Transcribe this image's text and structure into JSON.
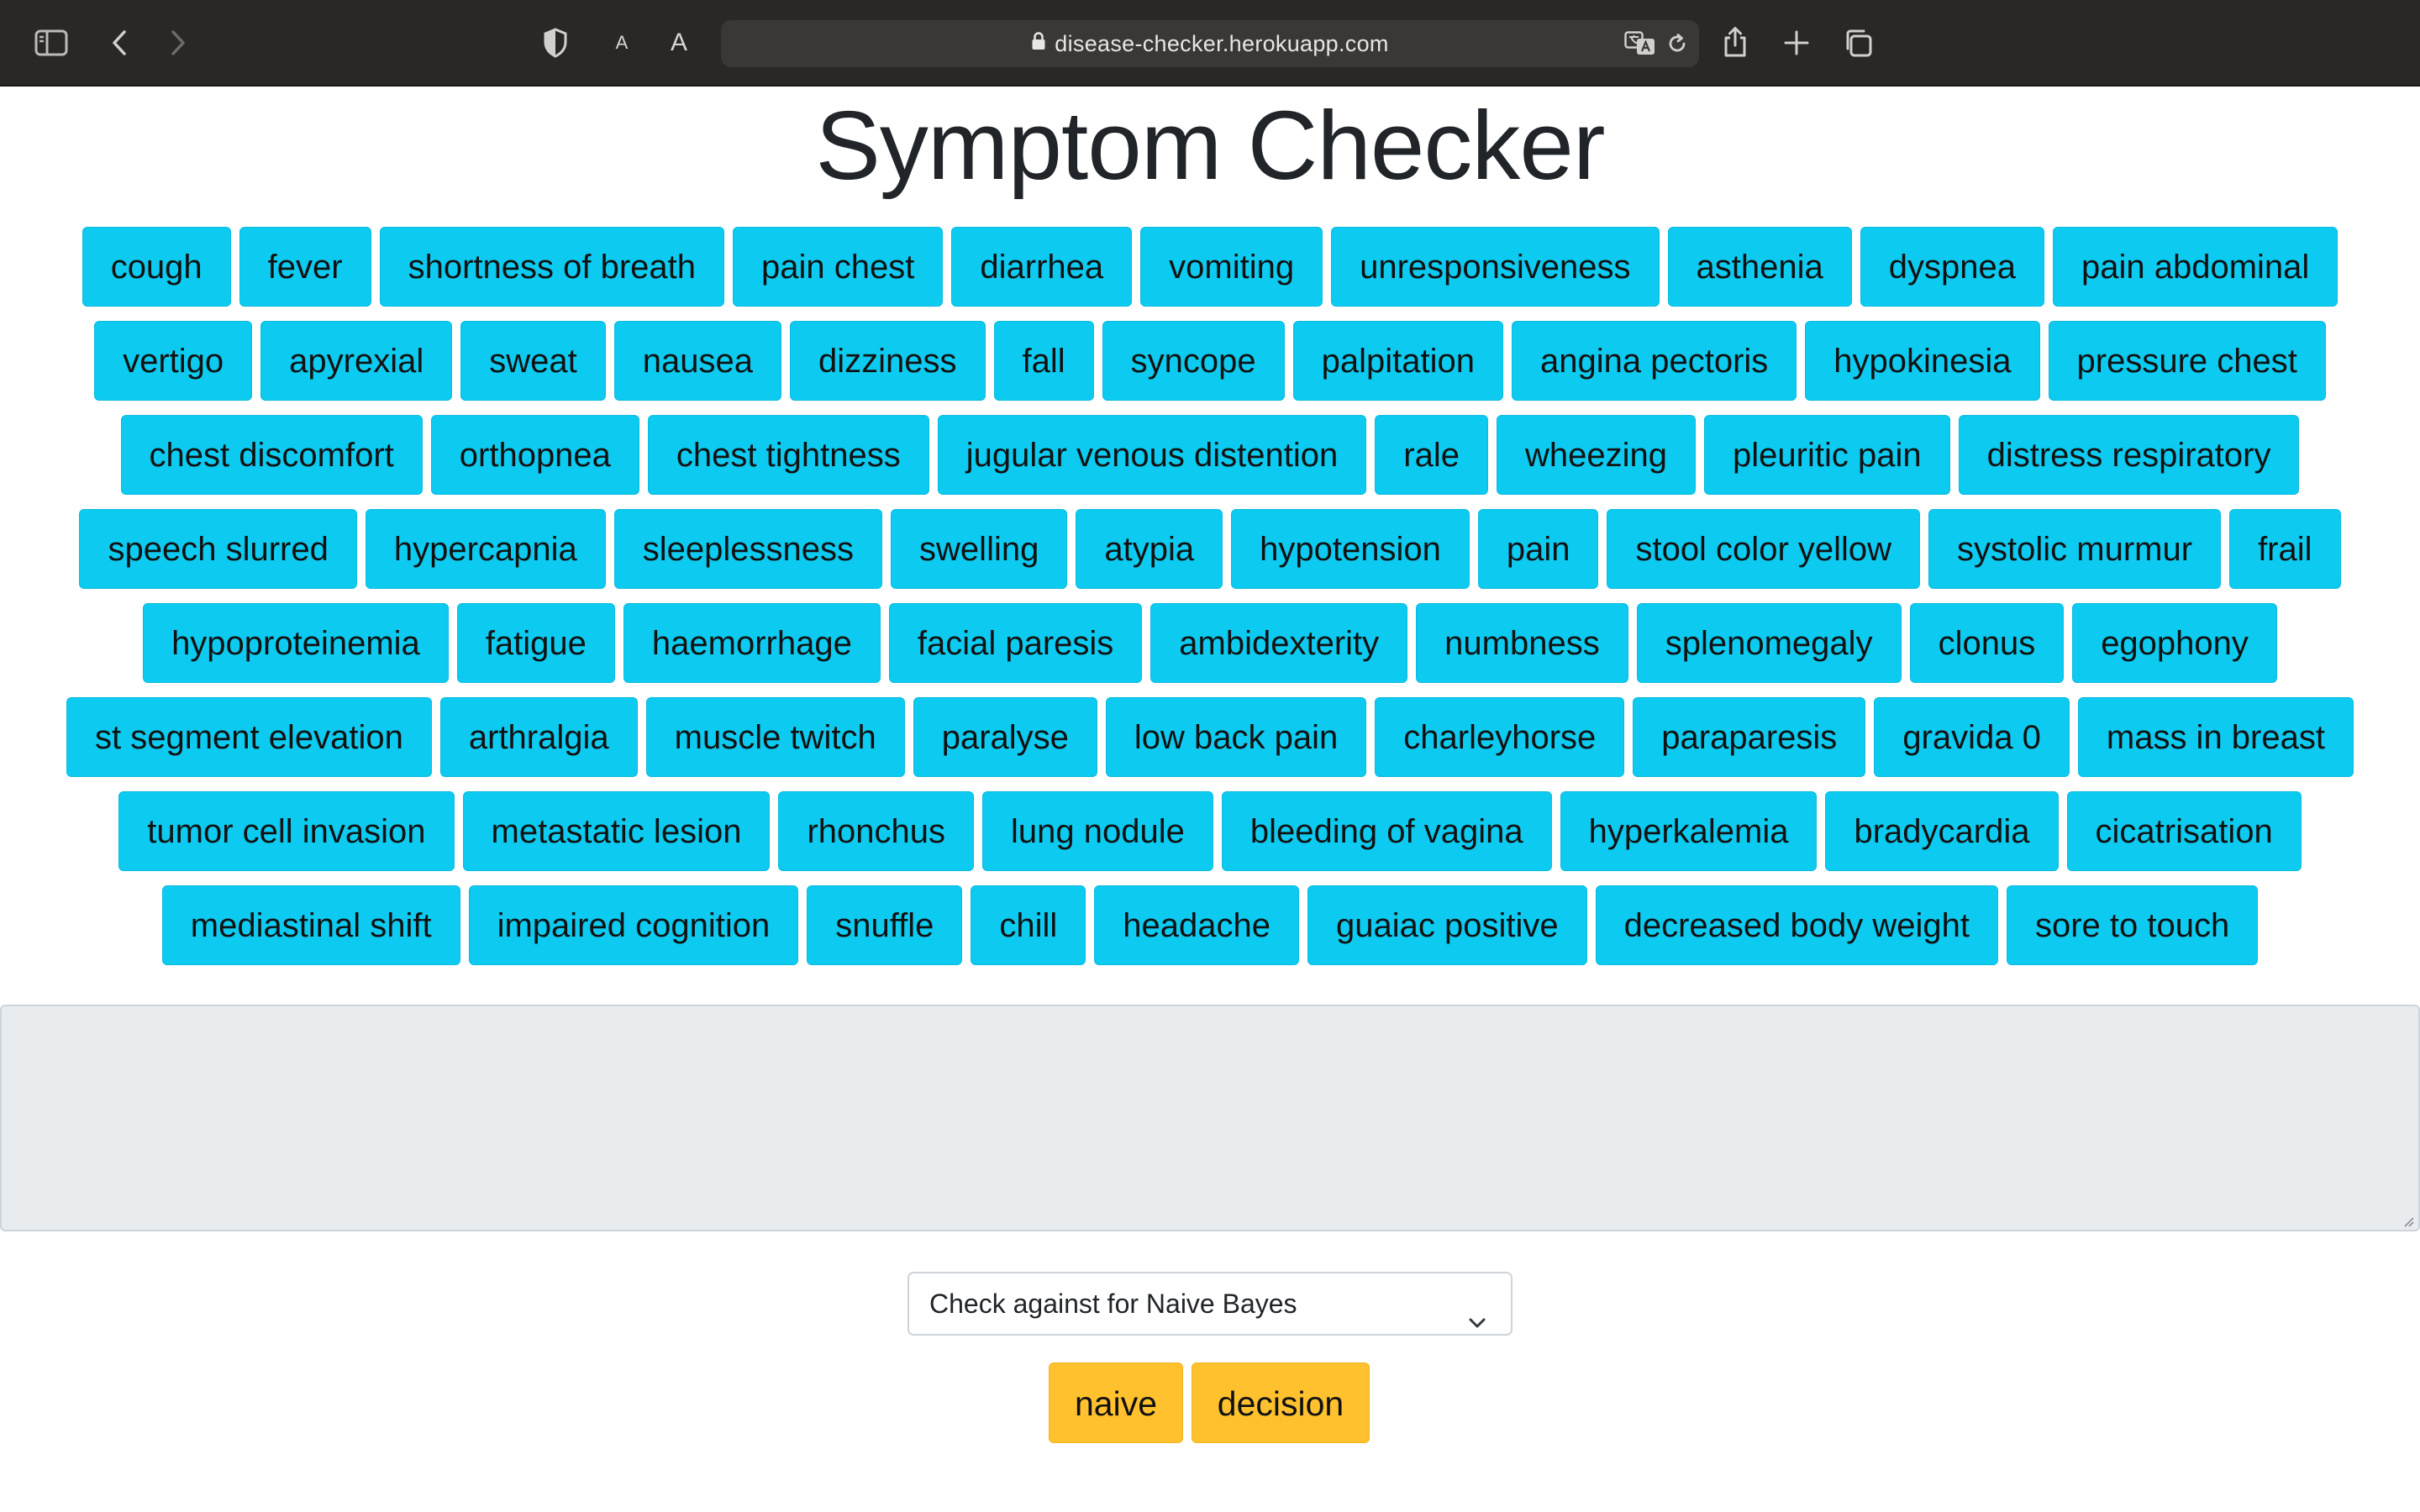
{
  "browser": {
    "url": "disease-checker.herokuapp.com",
    "reader_small": "A",
    "reader_large": "A"
  },
  "page": {
    "title": "Symptom Checker"
  },
  "symptoms": [
    "cough",
    "fever",
    "shortness of breath",
    "pain chest",
    "diarrhea",
    "vomiting",
    "unresponsiveness",
    "asthenia",
    "dyspnea",
    "pain abdominal",
    "vertigo",
    "apyrexial",
    "sweat",
    "nausea",
    "dizziness",
    "fall",
    "syncope",
    "palpitation",
    "angina pectoris",
    "hypokinesia",
    "pressure chest",
    "chest discomfort",
    "orthopnea",
    "chest tightness",
    "jugular venous distention",
    "rale",
    "wheezing",
    "pleuritic pain",
    "distress respiratory",
    "speech slurred",
    "hypercapnia",
    "sleeplessness",
    "swelling",
    "atypia",
    "hypotension",
    "pain",
    "stool color yellow",
    "systolic murmur",
    "frail",
    "hypoproteinemia",
    "fatigue",
    "haemorrhage",
    "facial paresis",
    "ambidexterity",
    "numbness",
    "splenomegaly",
    "clonus",
    "egophony",
    "st segment elevation",
    "arthralgia",
    "muscle twitch",
    "paralyse",
    "low back pain",
    "charleyhorse",
    "paraparesis",
    "gravida 0",
    "mass in breast",
    "tumor cell invasion",
    "metastatic lesion",
    "rhonchus",
    "lung nodule",
    "bleeding of vagina",
    "hyperkalemia",
    "bradycardia",
    "cicatrisation",
    "mediastinal shift",
    "impaired cognition",
    "snuffle",
    "chill",
    "headache",
    "guaiac positive",
    "decreased body weight",
    "sore to touch"
  ],
  "symptom_input": {
    "value": ""
  },
  "model_select": {
    "selected": "Check against for Naive Bayes"
  },
  "buttons": {
    "naive": "naive",
    "decision": "decision"
  },
  "colors": {
    "symptom_button": "#0dcaf0",
    "action_button": "#ffc12e",
    "textarea_bg": "#e9ecef",
    "chrome_bg": "#2b2725"
  }
}
